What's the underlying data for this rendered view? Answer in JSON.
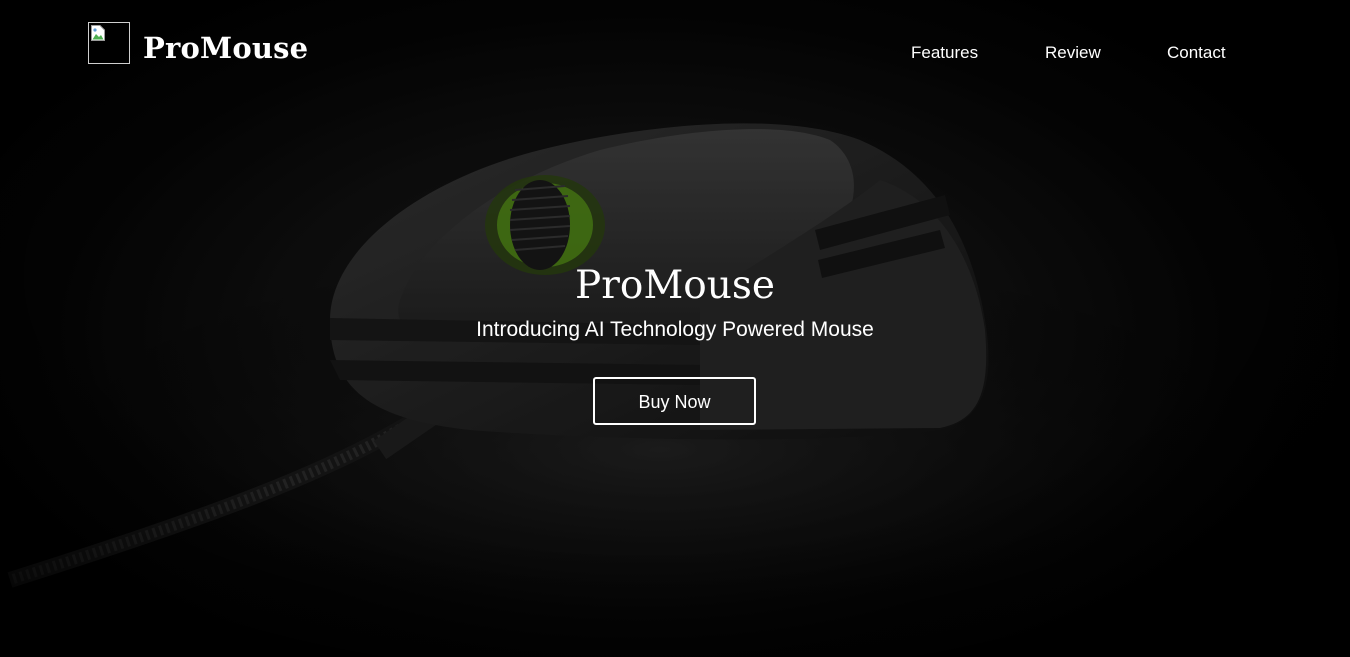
{
  "header": {
    "logo_alt": "logo",
    "brand": "ProMouse",
    "nav": {
      "features": "Features",
      "review": "Review",
      "contact": "Contact"
    }
  },
  "hero": {
    "title": "ProMouse",
    "subtitle": "Introducing AI Technology Powered Mouse",
    "cta": "Buy Now",
    "background_image": "gaming-mouse-photo"
  },
  "colors": {
    "background": "#000000",
    "text": "#ffffff",
    "accent_green": "#6fc21a"
  }
}
